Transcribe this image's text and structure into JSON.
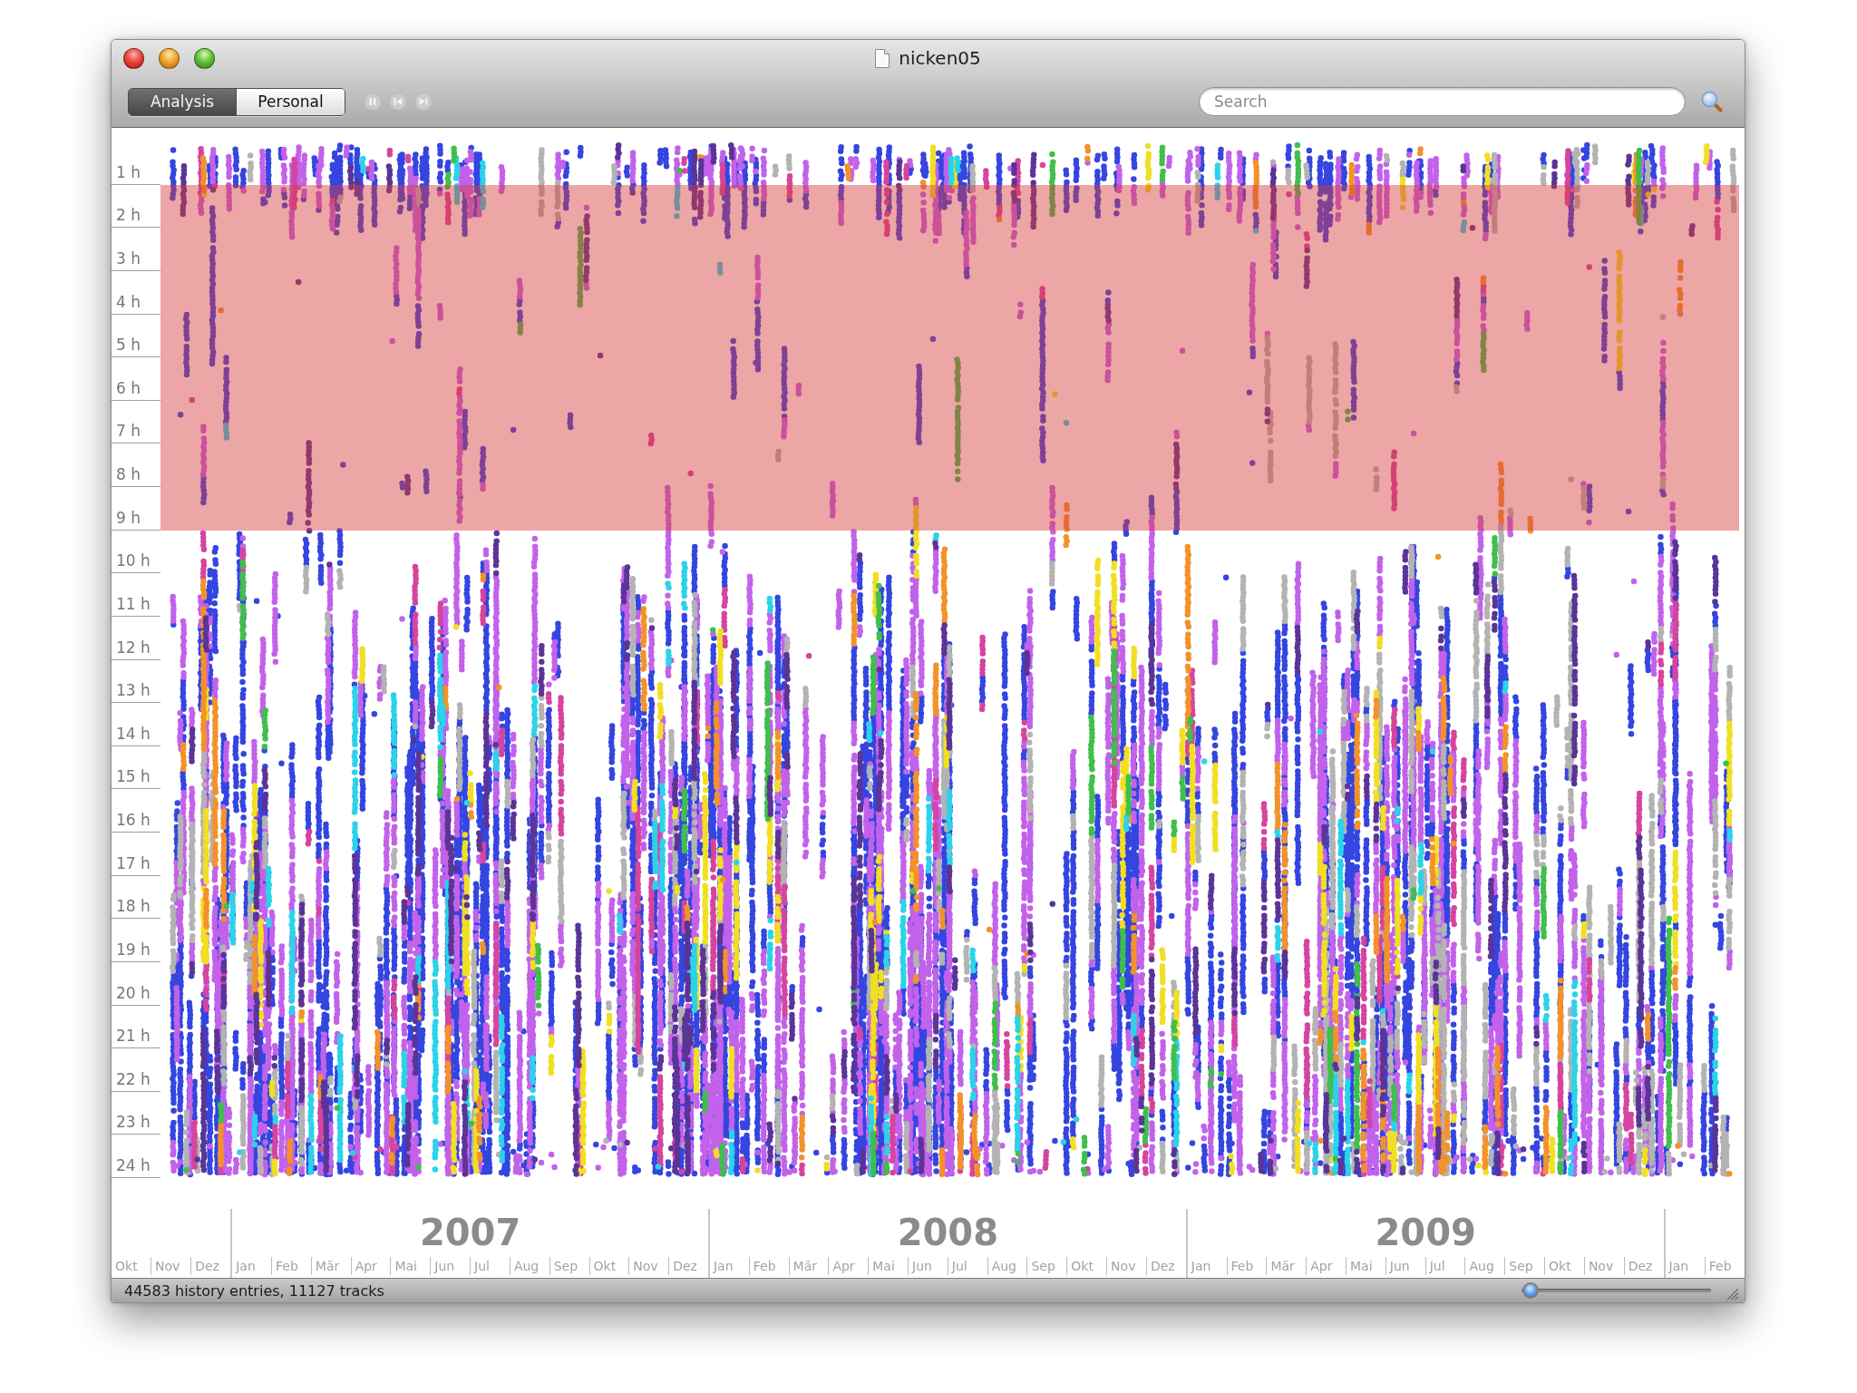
{
  "window": {
    "title": "nicken05"
  },
  "toolbar": {
    "view_tabs": [
      {
        "label": "Analysis",
        "selected": true
      },
      {
        "label": "Personal",
        "selected": false
      }
    ],
    "playback_buttons": [
      {
        "kind": "pause",
        "disabled": true
      },
      {
        "kind": "previous",
        "disabled": true
      },
      {
        "kind": "next",
        "disabled": true
      }
    ],
    "search": {
      "placeholder": "Search"
    }
  },
  "plot": {
    "hours": [
      {
        "label": "1 h",
        "selected": false
      },
      {
        "label": "2 h",
        "selected": true
      },
      {
        "label": "3 h",
        "selected": true
      },
      {
        "label": "4 h",
        "selected": true
      },
      {
        "label": "5 h",
        "selected": true
      },
      {
        "label": "6 h",
        "selected": true
      },
      {
        "label": "7 h",
        "selected": true
      },
      {
        "label": "8 h",
        "selected": true
      },
      {
        "label": "9 h",
        "selected": true
      },
      {
        "label": "10 h",
        "selected": false
      },
      {
        "label": "11 h",
        "selected": false
      },
      {
        "label": "12 h",
        "selected": false
      },
      {
        "label": "13 h",
        "selected": false
      },
      {
        "label": "14 h",
        "selected": false
      },
      {
        "label": "15 h",
        "selected": false
      },
      {
        "label": "16 h",
        "selected": false
      },
      {
        "label": "17 h",
        "selected": false
      },
      {
        "label": "18 h",
        "selected": false
      },
      {
        "label": "19 h",
        "selected": false
      },
      {
        "label": "20 h",
        "selected": false
      },
      {
        "label": "21 h",
        "selected": false
      },
      {
        "label": "22 h",
        "selected": false
      },
      {
        "label": "23 h",
        "selected": false
      },
      {
        "label": "24 h",
        "selected": false
      }
    ],
    "timeline": [
      {
        "months": [
          "Okt",
          "Nov",
          "Dez"
        ]
      },
      {
        "year": "2007",
        "months": [
          "Jan",
          "Feb",
          "Mär",
          "Apr",
          "Mai",
          "Jun",
          "Jul",
          "Aug",
          "Sep",
          "Okt",
          "Nov",
          "Dez"
        ]
      },
      {
        "year": "2008",
        "months": [
          "Jan",
          "Feb",
          "Mär",
          "Apr",
          "Mai",
          "Jun",
          "Jul",
          "Aug",
          "Sep",
          "Okt",
          "Nov",
          "Dez"
        ]
      },
      {
        "year": "2009",
        "months": [
          "Jan",
          "Feb",
          "Mär",
          "Apr",
          "Mai",
          "Jun",
          "Jul",
          "Aug",
          "Sep",
          "Okt",
          "Nov",
          "Dez"
        ]
      },
      {
        "months": [
          "Jan",
          "Feb"
        ]
      }
    ]
  },
  "status_bar": {
    "text": "44583 history entries, 11127 tracks",
    "zoom_slider": {
      "level": 0.05
    }
  }
}
